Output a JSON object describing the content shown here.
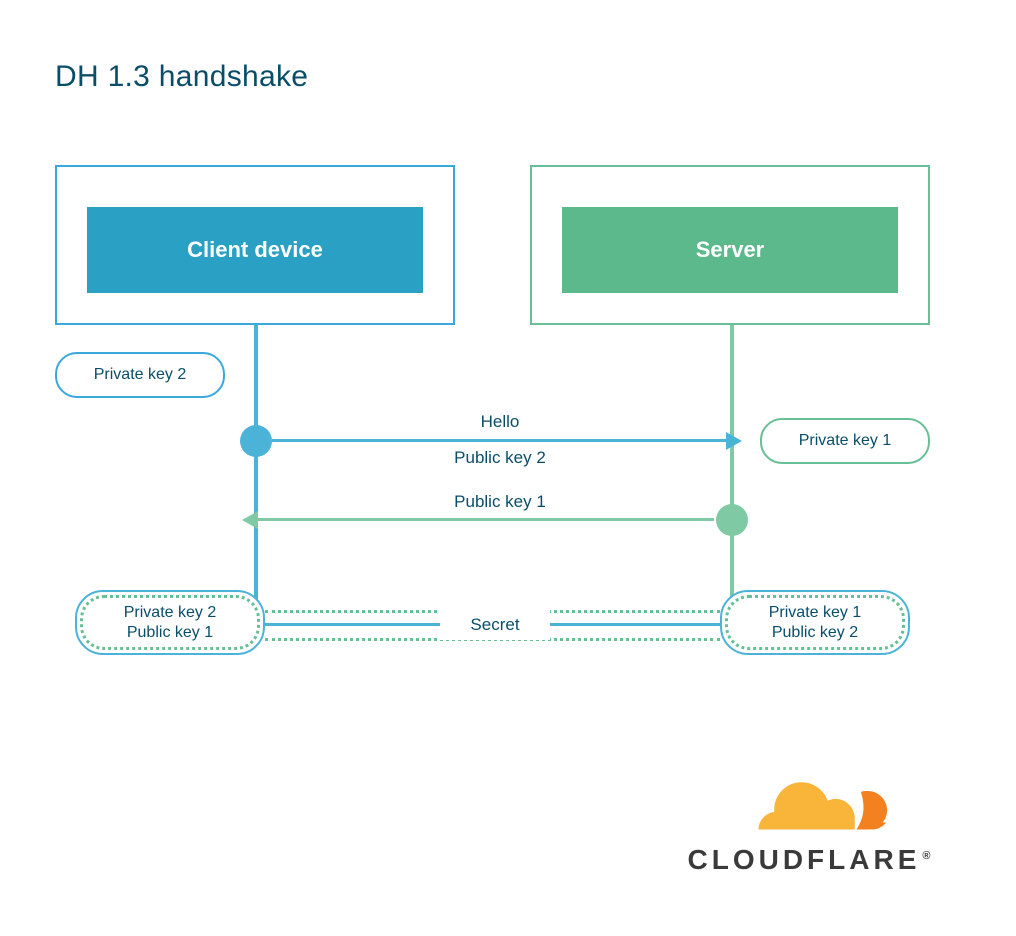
{
  "title": "DH 1.3 handshake",
  "client": {
    "label": "Client device"
  },
  "server": {
    "label": "Server"
  },
  "pills": {
    "client_private": "Private key 2",
    "server_private": "Private key 1"
  },
  "arrows": {
    "hello": "Hello",
    "public2": "Public key 2",
    "public1": "Public key 1"
  },
  "combo_left": {
    "line1": "Private key 2",
    "line2": "Public key 1"
  },
  "combo_right": {
    "line1": "Private key 1",
    "line2": "Public key 2"
  },
  "secret": "Secret",
  "brand": "CLOUDFLARE",
  "colors": {
    "blue": "#4bb3d8",
    "green": "#7fc9a4",
    "text": "#0a4d68",
    "orange": "#f48120"
  }
}
